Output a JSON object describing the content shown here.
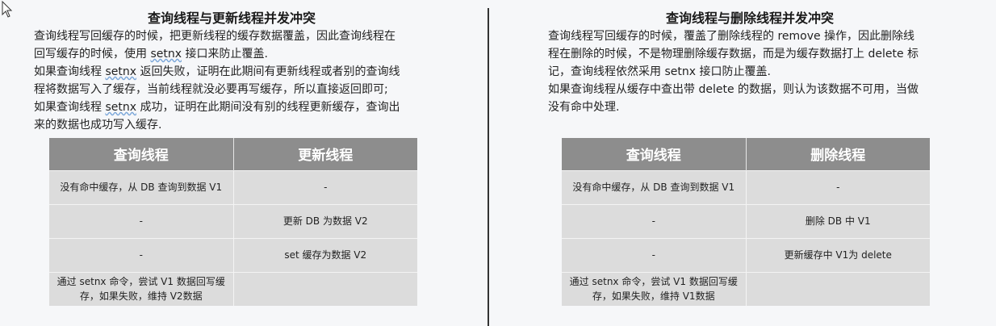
{
  "left": {
    "title": "查询线程与更新线程并发冲突",
    "lines": [
      "查询线程写回缓存的时候，把更新线程的缓存数据覆盖，因此查询线程在",
      "回写缓存的时候，使用 setnx 接口来防止覆盖.",
      "如果查询线程 setnx 返回失败，证明在此期间有更新线程或者别的查询线",
      "程将数据写入了缓存，当前线程就没必要再写缓存，所以直接返回即可;",
      "如果查询线程 setnx 成功，证明在此期间没有别的线程更新缓存，查询出",
      "来的数据也成功写入缓存."
    ],
    "table": {
      "headers": [
        "查询线程",
        "更新线程"
      ],
      "rows": [
        [
          "没有命中缓存，从 DB 查询到数据 V1",
          "-"
        ],
        [
          "-",
          "更新 DB 为数据 V2"
        ],
        [
          "-",
          "set 缓存为数据 V2"
        ],
        [
          "通过 setnx 命令，尝试 V1 数据回写缓存，如果失败，维持 V2数据",
          ""
        ]
      ]
    }
  },
  "right": {
    "title": "查询线程与删除线程并发冲突",
    "lines": [
      "查询线程写回缓存的时候，覆盖了删除线程的 remove 操作，因此删除线",
      "程在删除的时候，不是物理删除缓存数据，而是为缓存数据打上 delete 标",
      "记，查询线程依然采用 setnx 接口防止覆盖.",
      "如果查询线程从缓存中查出带 delete 的数据，则认为该数据不可用，当做",
      "没有命中处理."
    ],
    "table": {
      "headers": [
        "查询线程",
        "删除线程"
      ],
      "rows": [
        [
          "没有命中缓存，从 DB 查询到数据 V1",
          "-"
        ],
        [
          "-",
          "删除 DB 中 V1"
        ],
        [
          "-",
          "更新缓存中 V1为 delete"
        ],
        [
          "通过 setnx 命令，尝试 V1 数据回写缓存，如果失败，维持 V1数据",
          ""
        ]
      ]
    }
  },
  "icons": {
    "cursor": "mouse-pointer-icon"
  }
}
